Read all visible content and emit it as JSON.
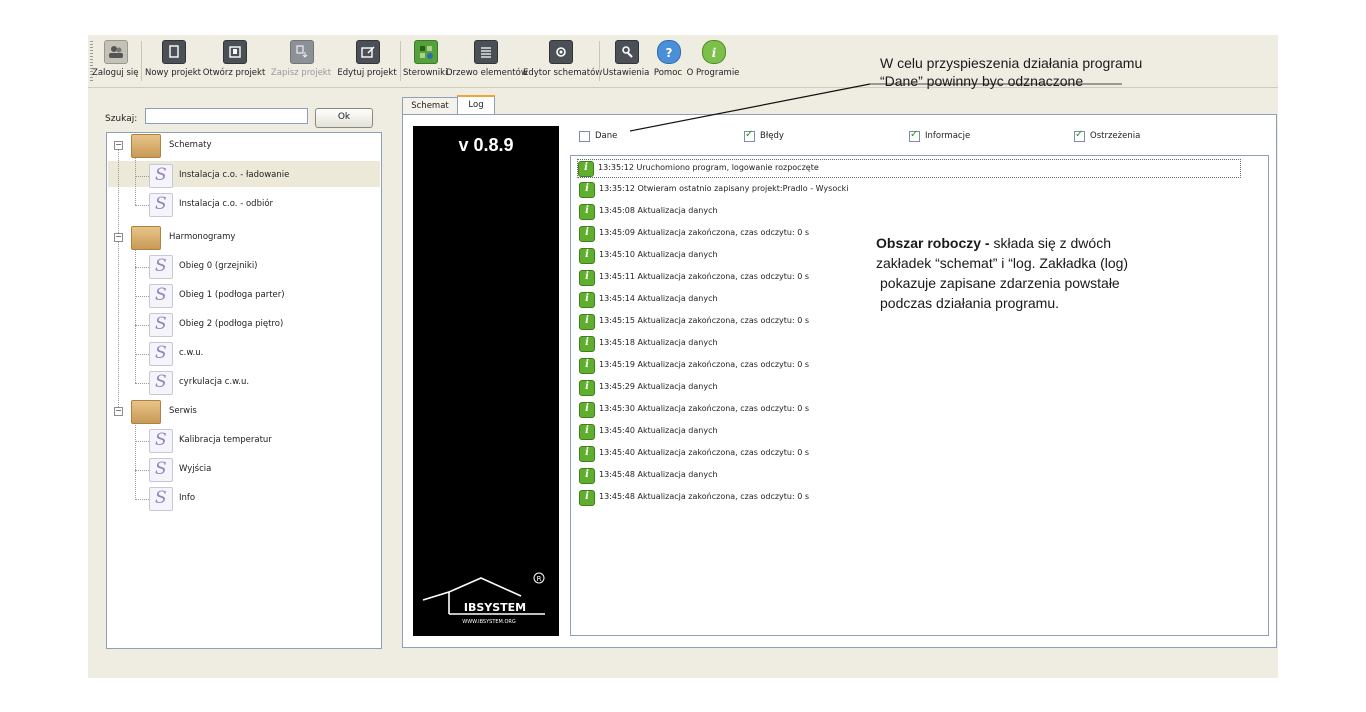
{
  "toolbar": {
    "buttons": [
      {
        "label": "Zaloguj się",
        "icon": "user-login-icon",
        "enabled": true
      },
      {
        "label": "Nowy projekt",
        "icon": "new-project-icon",
        "enabled": true
      },
      {
        "label": "Otwórz projekt",
        "icon": "open-project-icon",
        "enabled": true
      },
      {
        "label": "Zapisz projekt",
        "icon": "save-project-icon",
        "enabled": false
      },
      {
        "label": "Edytuj projekt",
        "icon": "edit-project-icon",
        "enabled": true
      },
      {
        "label": "Sterowniki",
        "icon": "controllers-icon",
        "enabled": true
      },
      {
        "label": "Drzewo elementów",
        "icon": "element-tree-icon",
        "enabled": true
      },
      {
        "label": "Edytor schematów",
        "icon": "schema-editor-icon",
        "enabled": true
      },
      {
        "label": "Ustawienia",
        "icon": "settings-icon",
        "enabled": true
      },
      {
        "label": "Pomoc",
        "icon": "help-icon",
        "enabled": true
      },
      {
        "label": "O Programie",
        "icon": "about-icon",
        "enabled": true
      }
    ]
  },
  "search": {
    "label": "Szukaj:",
    "value": "",
    "button": "Ok"
  },
  "tree": {
    "groups": [
      {
        "label": "Schematy",
        "items": [
          "Instalacja c.o. - ładowanie",
          "Instalacja c.o. - odbiór"
        ]
      },
      {
        "label": "Harmonogramy",
        "items": [
          "Obieg 0 (grzejniki)",
          "Obieg 1 (podłoga parter)",
          "Obieg 2 (podłoga piętro)",
          "c.w.u.",
          "cyrkulacja c.w.u."
        ]
      },
      {
        "label": "Serwis",
        "items": [
          "Kalibracja temperatur",
          "Wyjścia",
          "Info"
        ]
      }
    ],
    "selected": "Instalacja c.o. - ładowanie"
  },
  "tabs": [
    {
      "label": "Schemat",
      "active": false
    },
    {
      "label": "Log",
      "active": true
    }
  ],
  "banner": {
    "version": "v 0.8.9",
    "logo_text": "IBSYSTEM",
    "logo_url_text": "WWW.IBSYSTEM.ORG"
  },
  "filters": [
    {
      "label": "Dane",
      "checked": false
    },
    {
      "label": "Błędy",
      "checked": true
    },
    {
      "label": "Informacje",
      "checked": true
    },
    {
      "label": "Ostrzeżenia",
      "checked": true
    }
  ],
  "log": [
    "13:35:12 Uruchomiono program, logowanie rozpoczęte",
    "13:35:12 Otwieram ostatnio zapisany projekt:Pradlo - Wysocki",
    "13:45:08 Aktualizacja danych",
    "13:45:09 Aktualizacja zakończona, czas odczytu: 0 s",
    "13:45:10 Aktualizacja danych",
    "13:45:11 Aktualizacja zakończona, czas odczytu: 0 s",
    "13:45:14 Aktualizacja danych",
    "13:45:15 Aktualizacja zakończona, czas odczytu: 0 s",
    "13:45:18 Aktualizacja danych",
    "13:45:19 Aktualizacja zakończona, czas odczytu: 0 s",
    "13:45:29 Aktualizacja danych",
    "13:45:30 Aktualizacja zakończona, czas odczytu: 0 s",
    "13:45:40 Aktualizacja danych",
    "13:45:40 Aktualizacja zakończona, czas odczytu: 0 s",
    "13:45:48 Aktualizacja danych",
    "13:45:48 Aktualizacja zakończona, czas odczytu: 0 s"
  ],
  "annotations": {
    "top_line1": "W celu przyspieszenia działania programu",
    "top_line2": "“Dane” powinny byc odznaczone",
    "body_bold": "Obszar roboczy -",
    "body_rest1": " składa się z dwóch",
    "body_line2": "zakładek “schemat” i “log. Zakładka (log)",
    "body_line3": "pokazuje zapisane zdarzenia powstałe",
    "body_line4": "podczas działania programu."
  },
  "colors": {
    "accent_tab": "#f1a33a",
    "info_green": "#5fae2e",
    "window_bg": "#efece2",
    "border_blue": "#8da0b6"
  }
}
